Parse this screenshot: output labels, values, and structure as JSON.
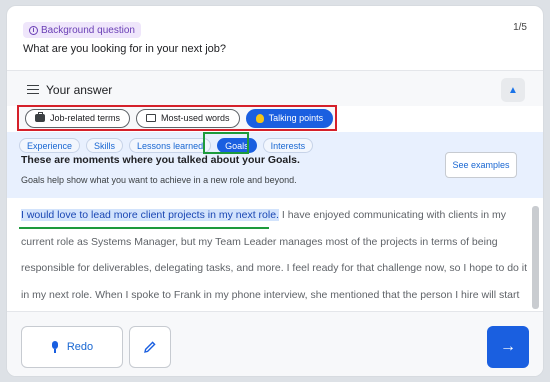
{
  "question": {
    "badge": "Background question",
    "text": "What are you looking for in your next job?",
    "counter": "1/5"
  },
  "answer": {
    "title": "Your answer"
  },
  "filters": [
    {
      "label": "Job-related terms",
      "icon": "briefcase-icon"
    },
    {
      "label": "Most-used words",
      "icon": "book-icon"
    },
    {
      "label": "Talking points",
      "icon": "lightbulb-icon",
      "active": true
    }
  ],
  "tabs": [
    {
      "label": "Experience"
    },
    {
      "label": "Skills"
    },
    {
      "label": "Lessons learned"
    },
    {
      "label": "Goals",
      "active": true
    },
    {
      "label": "Interests"
    }
  ],
  "panel": {
    "title": "These are moments where you talked about your Goals.",
    "subtitle": "Goals help show what you want to achieve in a new role and beyond.",
    "examples_label": "See examples"
  },
  "answer_text": {
    "highlight": "I would love to lead more client projects in my next role.",
    "rest": " I have enjoyed communicating with clients in my current role as Systems Manager, but my Team Leader manages most of the projects in terms of being responsible for deliverables, delegating tasks, and more. I feel ready for that challenge now, so I hope to do it in my next role. When I spoke to Frank in my phone interview, she mentioned that the person I hire will start out leading one or"
  },
  "controls": {
    "redo_label": "Redo"
  },
  "colors": {
    "accent": "#1a5fe0",
    "highlight_box": "#d5202a",
    "goals_box": "#1e9a3c"
  }
}
